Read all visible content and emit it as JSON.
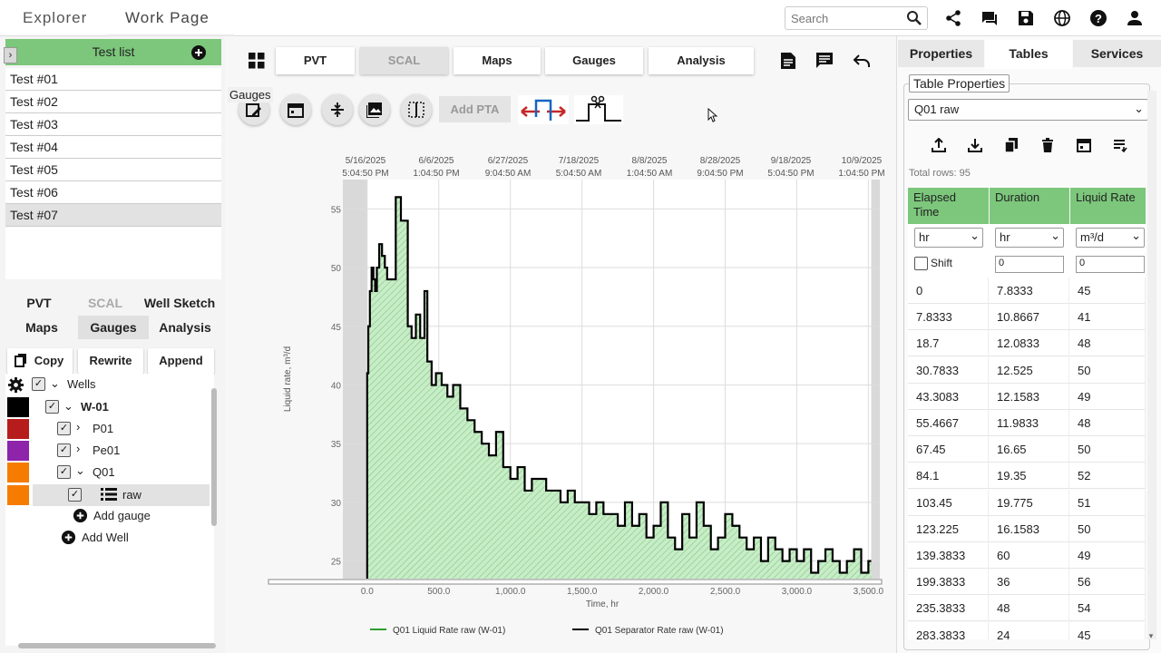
{
  "app": {
    "tabs": [
      "Explorer",
      "Work Page"
    ],
    "search_placeholder": "Search",
    "toolbar_icons": [
      "share-icon",
      "chat-icon",
      "save-icon",
      "globe-icon",
      "help-icon",
      "user-icon"
    ]
  },
  "left": {
    "list_title": "Test list",
    "tests": [
      "Test #01",
      "Test #02",
      "Test #03",
      "Test #04",
      "Test #05",
      "Test #06",
      "Test #07"
    ],
    "selected_test": "Test #07",
    "nav_row1": [
      "PVT",
      "SCAL",
      "Well Sketch"
    ],
    "nav_row2": [
      "Maps",
      "Gauges",
      "Analysis"
    ],
    "actions": [
      "Copy",
      "Rewrite",
      "Append"
    ],
    "tree": {
      "root": "Wells",
      "well": "W-01",
      "gauges": [
        "P01",
        "Pe01",
        "Q01"
      ],
      "leaf": "raw",
      "add_gauge": "Add gauge",
      "add_well": "Add Well",
      "colors": {
        "well": "#000000",
        "P01": "#b71c1c",
        "Pe01": "#8e24aa",
        "Q01": "#f57c00",
        "raw": "#f57c00"
      }
    }
  },
  "center": {
    "tabs": [
      "PVT",
      "SCAL",
      "Maps",
      "Gauges",
      "Analysis"
    ],
    "tooltip": "Gauges",
    "add_pta": "Add PTA"
  },
  "chart_data": {
    "type": "line",
    "top_ticks": [
      [
        "5/16/2025",
        "5:04:50 PM"
      ],
      [
        "6/6/2025",
        "1:04:50 PM"
      ],
      [
        "6/27/2025",
        "9:04:50 AM"
      ],
      [
        "7/18/2025",
        "5:04:50 AM"
      ],
      [
        "8/8/2025",
        "1:04:50 AM"
      ],
      [
        "8/28/2025",
        "9:04:50 PM"
      ],
      [
        "9/18/2025",
        "5:04:50 PM"
      ],
      [
        "10/9/2025",
        "1:04:50 PM"
      ]
    ],
    "x_ticks": [
      "0.0",
      "500.0",
      "1,000.0",
      "1,500.0",
      "2,000.0",
      "2,500.0",
      "3,000.0",
      "3,500.0"
    ],
    "y_ticks": [
      "25",
      "30",
      "35",
      "40",
      "45",
      "50",
      "55"
    ],
    "xlabel": "Time, hr",
    "ylabel": "Liquid rate, m³/d",
    "xlim": [
      -170,
      3580
    ],
    "ylim": [
      23.5,
      57.5
    ],
    "series": [
      {
        "name": "Q01 Liquid Rate raw (W-01)",
        "color": "#2e9e2e"
      },
      {
        "name": "Q01 Separator Rate raw (W-01)",
        "color": "#000000"
      }
    ],
    "x": [
      0,
      7.8,
      18.7,
      30.8,
      43.3,
      55.5,
      67.5,
      84.1,
      103.5,
      123.2,
      139.4,
      199.4,
      235.4,
      283.4,
      310,
      340,
      370,
      400,
      420,
      450,
      480,
      520,
      560,
      600,
      650,
      700,
      750,
      800,
      850,
      900,
      950,
      1000,
      1050,
      1100,
      1150,
      1200,
      1250,
      1300,
      1350,
      1400,
      1450,
      1500,
      1550,
      1600,
      1650,
      1700,
      1750,
      1800,
      1850,
      1900,
      1950,
      2000,
      2050,
      2100,
      2150,
      2200,
      2250,
      2300,
      2350,
      2400,
      2450,
      2500,
      2550,
      2600,
      2650,
      2700,
      2750,
      2800,
      2850,
      2900,
      2950,
      3000,
      3050,
      3100,
      3150,
      3200,
      3250,
      3300,
      3350,
      3400,
      3450,
      3500
    ],
    "y": [
      41,
      45,
      48,
      50,
      49,
      48,
      50,
      52,
      51,
      50,
      49,
      56,
      54,
      45,
      44,
      46,
      44,
      48,
      42,
      40,
      41,
      40,
      39,
      40,
      38,
      37,
      36,
      35,
      34,
      36,
      33,
      32,
      33,
      31,
      32,
      32,
      31,
      31,
      30,
      31,
      30,
      30,
      29,
      30,
      29,
      29,
      28,
      30,
      28,
      29,
      27,
      28,
      30,
      27,
      26,
      29,
      27,
      30,
      28,
      26,
      27,
      29,
      28,
      27,
      26,
      27,
      25,
      27,
      26,
      25,
      26,
      25,
      26,
      24,
      25,
      26,
      25,
      24,
      25,
      26,
      24,
      25
    ],
    "legend_placement": "bottom",
    "grid": true
  },
  "right": {
    "tabs": [
      "Properties",
      "Tables",
      "Services"
    ],
    "table_props_title": "Table Properties",
    "table_select": "Q01 raw",
    "total_rows": "Total rows: 95",
    "columns": [
      "Elapsed Time",
      "Duration",
      "Liquid Rate"
    ],
    "units": [
      "hr",
      "hr",
      "m³/d"
    ],
    "shift_label": "Shift",
    "shift_values": [
      "0",
      "0"
    ],
    "rows": [
      [
        "0",
        "7.8333",
        "45"
      ],
      [
        "7.8333",
        "10.8667",
        "41"
      ],
      [
        "18.7",
        "12.0833",
        "48"
      ],
      [
        "30.7833",
        "12.525",
        "50"
      ],
      [
        "43.3083",
        "12.1583",
        "49"
      ],
      [
        "55.4667",
        "11.9833",
        "48"
      ],
      [
        "67.45",
        "16.65",
        "50"
      ],
      [
        "84.1",
        "19.35",
        "52"
      ],
      [
        "103.45",
        "19.775",
        "51"
      ],
      [
        "123.225",
        "16.1583",
        "50"
      ],
      [
        "139.3833",
        "60",
        "49"
      ],
      [
        "199.3833",
        "36",
        "56"
      ],
      [
        "235.3833",
        "48",
        "54"
      ],
      [
        "283.3833",
        "24",
        "45"
      ]
    ]
  }
}
